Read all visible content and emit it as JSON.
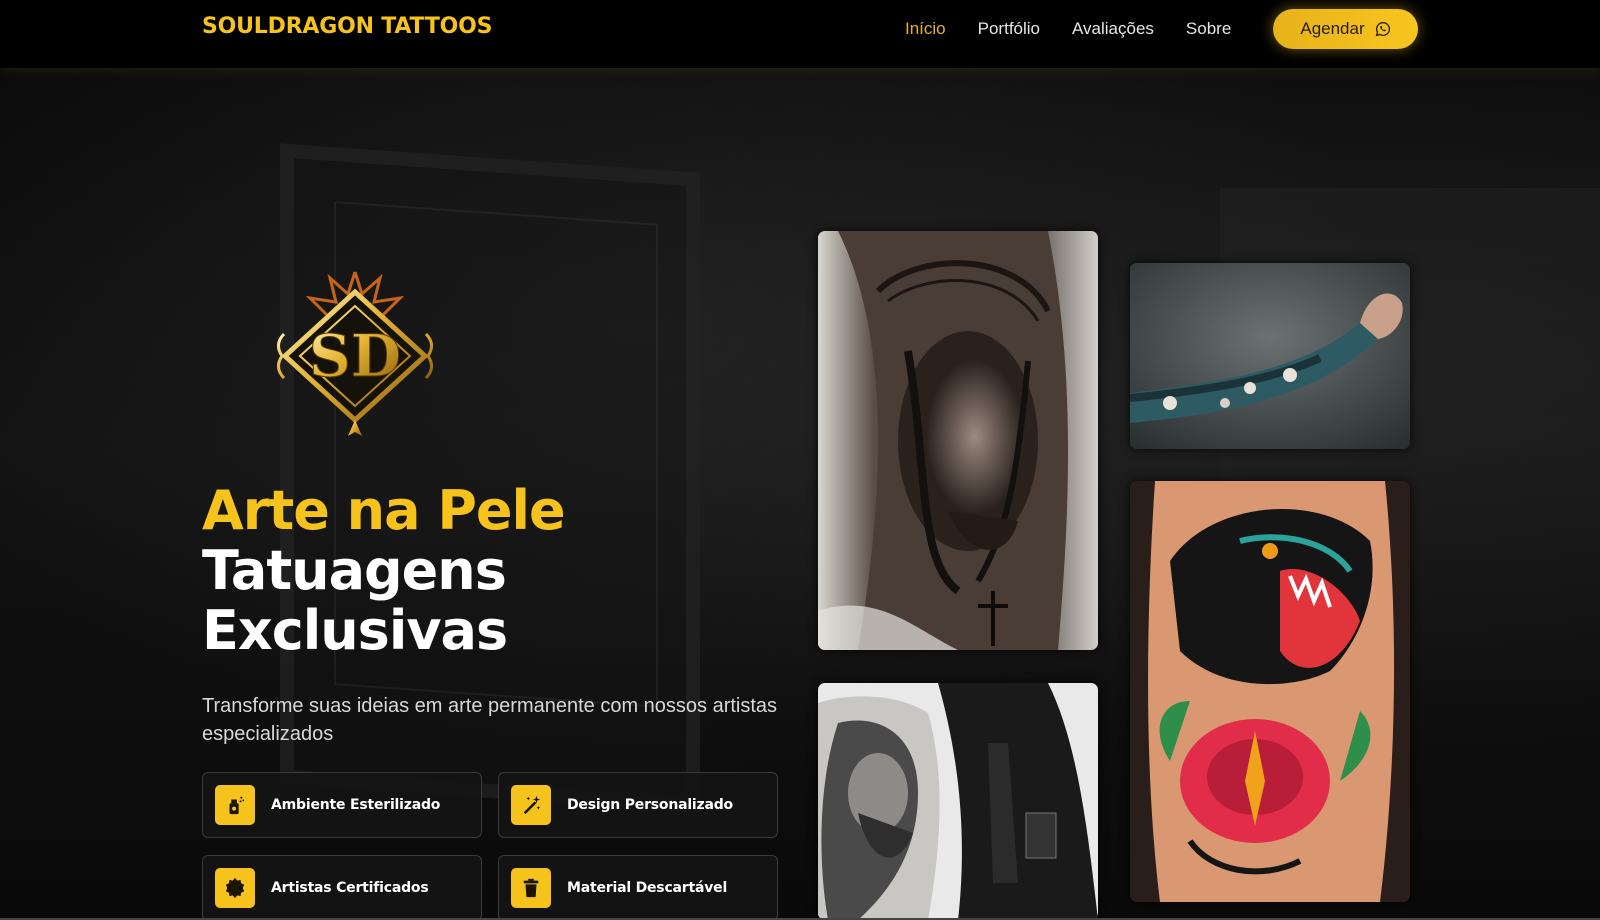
{
  "nav": {
    "brand": "SOULDRAGON TATTOOS",
    "links": [
      {
        "label": "Início",
        "active": true
      },
      {
        "label": "Portfólio",
        "active": false
      },
      {
        "label": "Avaliações",
        "active": false
      },
      {
        "label": "Sobre",
        "active": false
      }
    ],
    "cta_label": "Agendar",
    "cta_icon": "whatsapp-icon"
  },
  "hero": {
    "title_gold": "Arte na Pele",
    "title_line2": "Tatuagens",
    "title_line3": "Exclusivas",
    "subtitle": "Transforme suas ideias em arte permanente com nossos artistas especializados",
    "logo_text": "SD",
    "features": [
      {
        "label": "Ambiente Esterilizado",
        "icon": "spray-icon"
      },
      {
        "label": "Design Personalizado",
        "icon": "magic-wand-icon"
      },
      {
        "label": "Artistas Certificados",
        "icon": "certificate-icon"
      },
      {
        "label": "Material Descartável",
        "icon": "trash-icon"
      }
    ]
  },
  "gallery": [
    {
      "subject": "jesus-portrait-tattoo"
    },
    {
      "subject": "japanese-sleeve-tattoo"
    },
    {
      "subject": "panther-rose-tattoo"
    },
    {
      "subject": "zeus-sleeve-tattoo"
    }
  ],
  "colors": {
    "accent": "#f6c21c",
    "nav_active": "#e5b02a",
    "background": "#050505"
  }
}
